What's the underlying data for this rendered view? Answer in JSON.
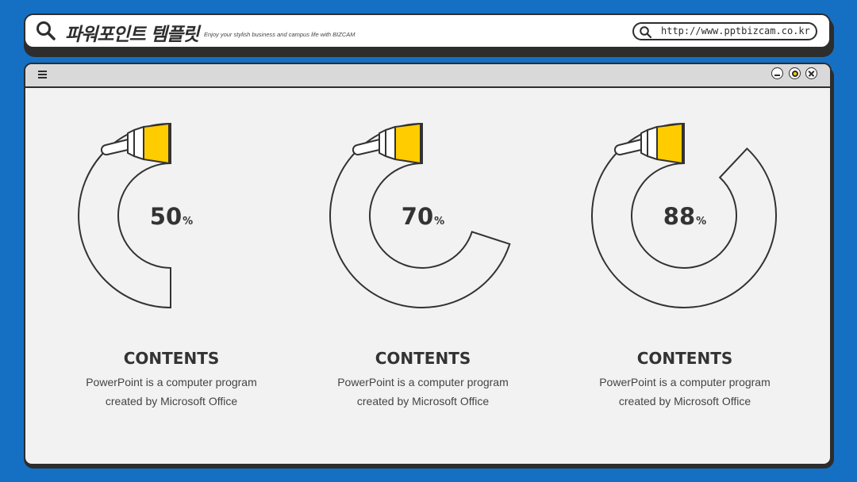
{
  "header": {
    "brand_title": "파워포인트 템플릿",
    "brand_subtitle": "Enjoy your stylish business and campus life with BIZCAM",
    "search_icon": "search-icon",
    "url": "http://www.pptbizcam.co.kr"
  },
  "window": {
    "menu_icon": "hamburger-menu-icon",
    "controls": [
      "minimize",
      "maximize",
      "close"
    ]
  },
  "accent_color": "#ffcc00",
  "cards": [
    {
      "value": 50,
      "unit": "%",
      "title": "CONTENTS",
      "desc_line1": "PowerPoint is a computer program",
      "desc_line2": "created by Microsoft Office"
    },
    {
      "value": 70,
      "unit": "%",
      "title": "CONTENTS",
      "desc_line1": "PowerPoint is a computer program",
      "desc_line2": "created by Microsoft Office"
    },
    {
      "value": 88,
      "unit": "%",
      "title": "CONTENTS",
      "desc_line1": "PowerPoint is a computer program",
      "desc_line2": "created by Microsoft Office"
    }
  ]
}
